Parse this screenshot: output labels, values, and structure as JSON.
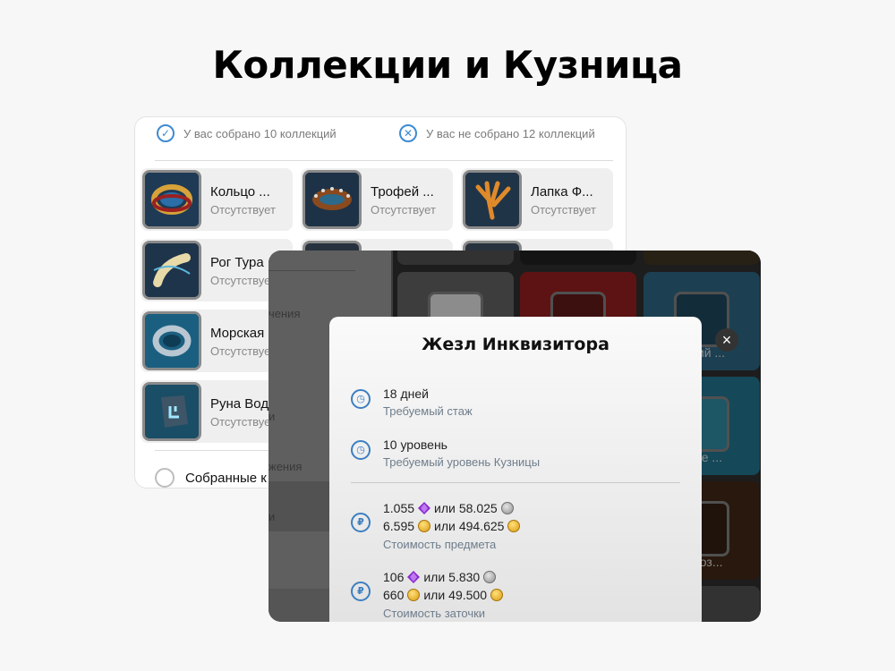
{
  "hero": {
    "title": "Коллекции и Кузница"
  },
  "summary": {
    "collected": "У вас собрано 10 коллекций",
    "not_collected": "У вас не собрано 12 коллекций"
  },
  "collections": [
    {
      "name": "Кольцо ...",
      "status": "Отсутствует",
      "icon": "ring-icon"
    },
    {
      "name": "Трофей ...",
      "status": "Отсутствует",
      "icon": "spiked-belt-icon"
    },
    {
      "name": "Лапка Ф...",
      "status": "Отсутствует",
      "icon": "claw-icon"
    },
    {
      "name": "Рог Тура",
      "status": "Отсутствует",
      "icon": "horn-icon"
    },
    {
      "name": "Морская",
      "status": "Отсутствует",
      "icon": "sea-ring-icon"
    },
    {
      "name": "Руна Вод",
      "status": "Отсутствует",
      "icon": "rune-icon"
    }
  ],
  "filter": {
    "label": "Собранные к"
  },
  "forge": {
    "sidebar_texts": [
      "чения",
      "и",
      "жения",
      "и"
    ],
    "grid_labels": [
      "йский ...",
      "овое ...",
      "а Доз..."
    ]
  },
  "modal": {
    "title": "Жезл Инквизитора",
    "close": "×",
    "stage": {
      "value": "18 дней",
      "label": "Требуемый стаж"
    },
    "level": {
      "value": "10 уровень",
      "label": "Требуемый уровень Кузницы"
    },
    "price": {
      "line1_a": "1.055",
      "or1": "или",
      "line1_b": "58.025",
      "line2_a": "6.595",
      "or2": "или",
      "line2_b": "494.625",
      "label": "Стоимость предмета"
    },
    "sharpen": {
      "line1_a": "106",
      "or1": "или",
      "line1_b": "5.830",
      "line2_a": "660",
      "or2": "или",
      "line2_b": "49.500",
      "label": "Стоимость заточки"
    }
  }
}
